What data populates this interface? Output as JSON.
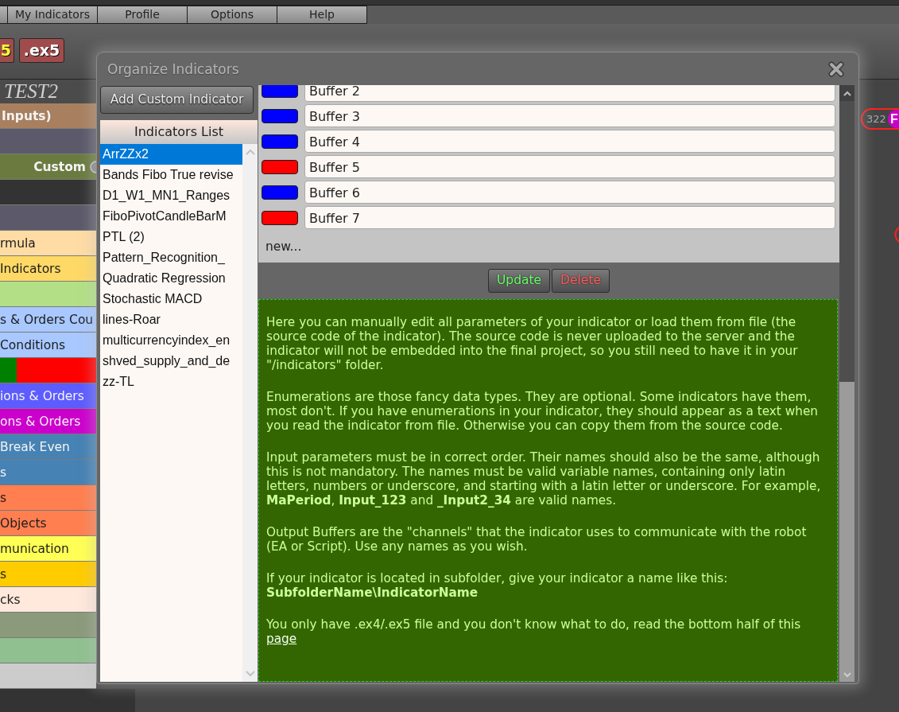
{
  "menu_bar": {
    "items": [
      {
        "label": "My Indicators"
      },
      {
        "label": "Profile"
      },
      {
        "label": "Options"
      },
      {
        "label": "Help"
      }
    ]
  },
  "toolbar": {
    "buttons": [
      {
        "label": "5",
        "color": "#ffff33"
      },
      {
        "label": ".ex5",
        "color": "#ffffff"
      }
    ]
  },
  "sidebar": {
    "title": "TEST2",
    "items": [
      {
        "kind": "heading",
        "label": "Inputs)",
        "color": "#a8805f"
      },
      {
        "kind": "item",
        "color": "#5c5a6a"
      },
      {
        "kind": "toggle",
        "label": "Custom",
        "color": "#6b7b40"
      },
      {
        "kind": "item",
        "color": "#333333"
      },
      {
        "kind": "item",
        "color": "#5c5a6a"
      },
      {
        "kind": "item",
        "label": "rmula",
        "color": "#ffdca4"
      },
      {
        "kind": "item",
        "label": "Indicators",
        "color": "#ffd966"
      },
      {
        "kind": "item",
        "color": "#b3e086"
      },
      {
        "kind": "item",
        "label": "s & Orders Cou",
        "color": "#a8c8ff"
      },
      {
        "kind": "item",
        "label": "Conditions",
        "color": "#a8c8ff"
      },
      {
        "kind": "split",
        "segments": [
          {
            "color": "#008000"
          },
          {
            "color": "#ff0000"
          }
        ]
      },
      {
        "kind": "item",
        "label": "ions & Orders",
        "color": "#5c5cff"
      },
      {
        "kind": "item",
        "label": "ons & Orders",
        "color": "#cc00cc"
      },
      {
        "kind": "item",
        "label": "Break Even",
        "color": "#4682b4"
      },
      {
        "kind": "item",
        "label": "s",
        "color": "#4682b4"
      },
      {
        "kind": "item",
        "label": "s",
        "color": "#ff7f50"
      },
      {
        "kind": "item",
        "label": "Objects",
        "color": "#ff7f50"
      },
      {
        "kind": "item",
        "label": "munication",
        "color": "#ffff55"
      },
      {
        "kind": "item",
        "label": "s",
        "color": "#ffcc00"
      },
      {
        "kind": "item",
        "label": "cks",
        "color": "#ffe8dc"
      },
      {
        "kind": "item",
        "color": "#8a9a7a"
      },
      {
        "kind": "item",
        "color": "#90c090"
      },
      {
        "kind": "item",
        "color": "#cccccc"
      }
    ]
  },
  "canvas": {
    "blocks": [
      {
        "number": "322",
        "letter": "F"
      }
    ]
  },
  "dialog": {
    "title": "Organize Indicators",
    "add_button": "Add Custom Indicator",
    "list": {
      "header": "Indicators List",
      "items": [
        {
          "label": "ArrZZx2",
          "selected": true
        },
        {
          "label": "Bands Fibo True revise",
          "selected": false
        },
        {
          "label": "D1_W1_MN1_Ranges",
          "selected": false
        },
        {
          "label": "FiboPivotCandleBarM",
          "selected": false
        },
        {
          "label": "PTL (2)",
          "selected": false
        },
        {
          "label": "Pattern_Recognition_",
          "selected": false
        },
        {
          "label": "Quadratic Regression",
          "selected": false
        },
        {
          "label": "Stochastic MACD",
          "selected": false
        },
        {
          "label": "lines-Roar",
          "selected": false
        },
        {
          "label": "multicurrencyindex_en",
          "selected": false
        },
        {
          "label": "shved_supply_and_de",
          "selected": false
        },
        {
          "label": "zz-TL",
          "selected": false
        }
      ]
    },
    "buffers": [
      {
        "name": "Buffer 2",
        "color": "#0000ff"
      },
      {
        "name": "Buffer 3",
        "color": "#0000ff"
      },
      {
        "name": "Buffer 4",
        "color": "#0000ff"
      },
      {
        "name": "Buffer 5",
        "color": "#ff0000"
      },
      {
        "name": "Buffer 6",
        "color": "#0000ff"
      },
      {
        "name": "Buffer 7",
        "color": "#ff0000"
      }
    ],
    "new_label": "new...",
    "buttons": [
      {
        "label": "Update",
        "kind": "update"
      },
      {
        "label": "Delete",
        "kind": "delete"
      }
    ],
    "help": {
      "paragraphs": [
        {
          "text": "Here you can manually edit all parameters of your indicator or load them from file (the source code of the indicator). The source code is never uploaded to the server and the indicator will not be embedded into the final project, so you still need to have it in your \"/indicators\" folder."
        },
        {
          "text": "Enumerations are those fancy data types. They are optional. Some indicators have them, most don't. If you have enumerations in your indicator, they should appear as a text when you read the indicator from file. Otherwise you can copy them from the source code."
        },
        {
          "text": "Input parameters must be in correct order. Their names should also be the same, although this is not mandatory. The names must be valid variable names, containing only latin letters, numbers or underscore, and starting with a latin letter or underscore. For example, **MaPeriod**, **Input_123** and **_Input2_34** are valid names."
        },
        {
          "text": "Output Buffers are the \"channels\" that the indicator uses to communicate with the robot (EA or Script). Use any names as you wish."
        },
        {
          "text": "If your indicator is located in subfolder, give your indicator a name like this: **SubfolderName\\IndicatorName**"
        },
        {
          "text": "You only have .ex4/.ex5 file and you don't know what to do, read the bottom half of this",
          "link": "page"
        }
      ]
    }
  }
}
